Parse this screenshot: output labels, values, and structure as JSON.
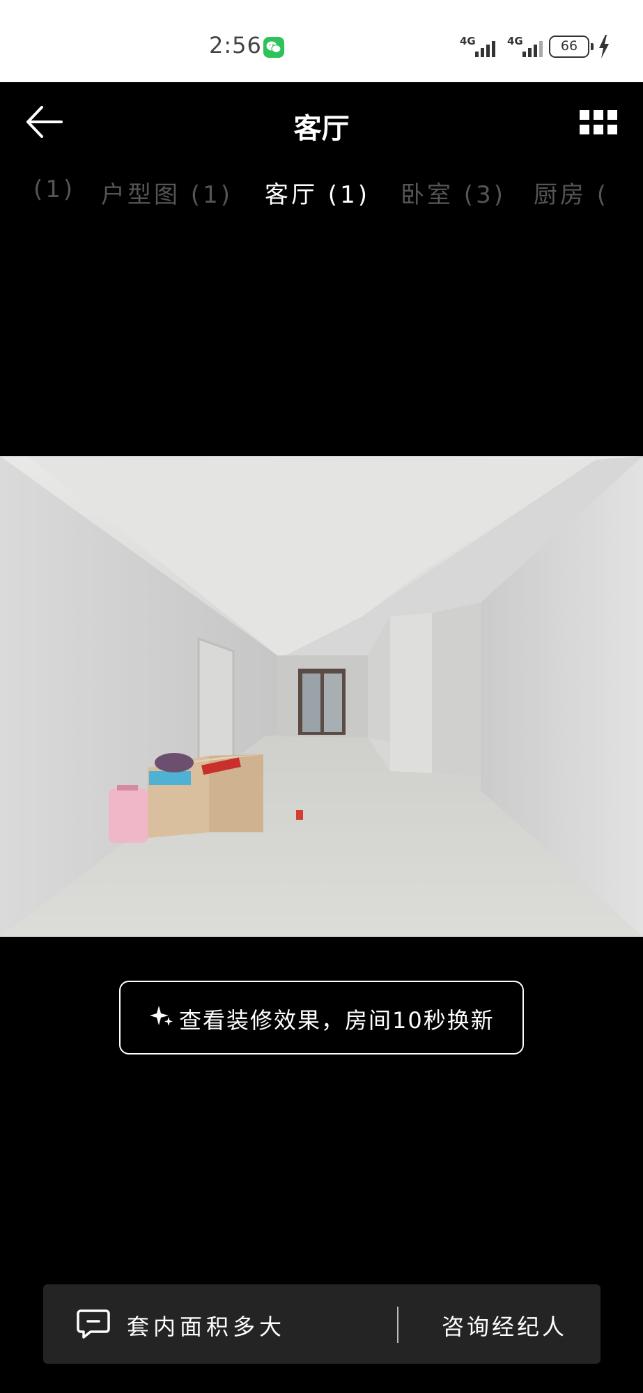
{
  "status_bar": {
    "time": "2:56",
    "network1": "4G",
    "network2": "4G",
    "battery": "66",
    "icons": [
      "wechat-icon",
      "signal-icon",
      "battery-icon",
      "charging-icon"
    ]
  },
  "header": {
    "title": "客厅",
    "icons": [
      "back-arrow-icon",
      "grid-menu-icon"
    ]
  },
  "tabs": [
    {
      "label": "(1)"
    },
    {
      "label": "户型图 (1)"
    },
    {
      "label": "客厅 (1)"
    },
    {
      "label": "卧室 (3)"
    },
    {
      "label": "厨房 ("
    }
  ],
  "active_tab": "客厅 (1)",
  "decor_button": {
    "label": "查看装修效果，房间10秒换新",
    "icon": "sparkle-icon"
  },
  "bottom_bar": {
    "ask_label": "套内面积多大",
    "consult_label": "咨询经纪人",
    "icon": "chat-bubble-icon"
  },
  "colors": {
    "background": "#000000",
    "status_bar": "#ffffff",
    "bottom_bar": "#242424",
    "wechat_green": "#2ec25a",
    "inactive_tab": "#555555"
  }
}
